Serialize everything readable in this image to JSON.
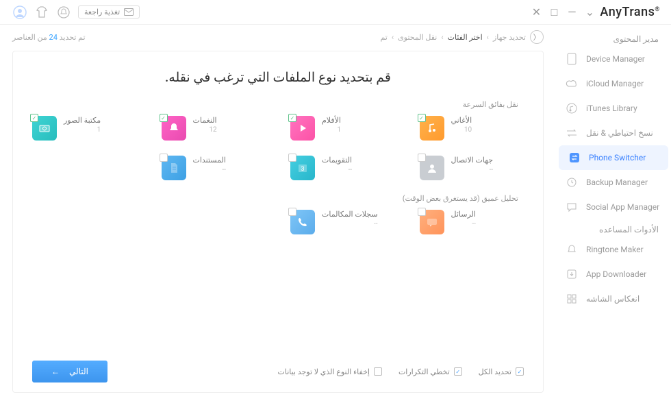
{
  "app": {
    "title": "AnyTrans",
    "reg": "®"
  },
  "topbar": {
    "feedback_label": "تغذية راجعة"
  },
  "sidebar": {
    "sections": {
      "content": "مدير المحتوى",
      "tools": "الأدوات المساعده"
    },
    "items": [
      {
        "label": "Device Manager"
      },
      {
        "label": "iCloud Manager"
      },
      {
        "label": "iTunes Library"
      },
      {
        "label": "نسخ احتياطي & نقل"
      },
      {
        "label": "Phone Switcher"
      },
      {
        "label": "Backup Manager"
      },
      {
        "label": "Social App Manager"
      },
      {
        "label": "Ringtone Maker"
      },
      {
        "label": "App Downloader"
      },
      {
        "label": "انعكاس الشاشه"
      }
    ]
  },
  "breadcrumbs": {
    "items": [
      "تحديد جهاز",
      "اختر الفئات",
      "نقل المحتوى",
      "تم"
    ],
    "active_index": 1
  },
  "status": {
    "prefix": "تم تحديد ",
    "count": "24",
    "suffix": " من العناصر"
  },
  "heading": "قم بتحديد نوع الملفات التي ترغب في نقله.",
  "groups": {
    "fast": "نقل بفائق السرعة",
    "deep": "تحليل عميق (قد يستغرق بعض الوقت)"
  },
  "tiles": {
    "songs": {
      "label": "الأغاني",
      "count": "10"
    },
    "movies": {
      "label": "الأفلام",
      "count": "1"
    },
    "ringtones": {
      "label": "النغمات",
      "count": "12"
    },
    "photos": {
      "label": "مكتبة الصور",
      "count": "1"
    },
    "contacts": {
      "label": "جهات الاتصال",
      "count": "--"
    },
    "calendars": {
      "label": "التقويمات",
      "count": "--"
    },
    "docs": {
      "label": "المستندات",
      "count": "--"
    },
    "messages": {
      "label": "الرسائل",
      "count": "--"
    },
    "calllog": {
      "label": "سجلات المكالمات",
      "count": "--"
    }
  },
  "options": {
    "select_all": "تحديد الكل",
    "skip_dupes": "تخطي التكرارات",
    "hide_empty": "إخفاء النوع الذي لا توجد بيانات"
  },
  "next": "التالي"
}
